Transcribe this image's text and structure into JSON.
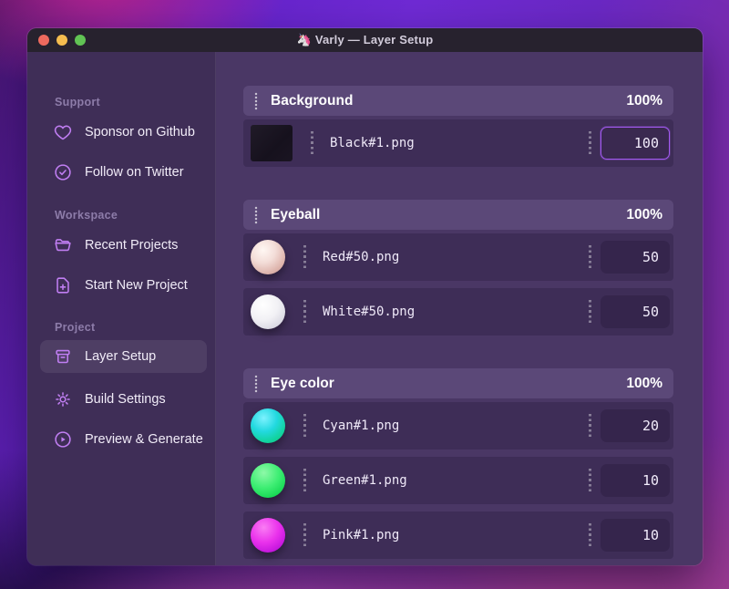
{
  "window": {
    "app_icon": "🦄",
    "title": "Varly — Layer Setup"
  },
  "sidebar": {
    "sections": [
      {
        "label": "Support",
        "items": [
          {
            "icon": "heart-icon",
            "label": "Sponsor on Github"
          },
          {
            "icon": "badge-check-icon",
            "label": "Follow on Twitter"
          }
        ]
      },
      {
        "label": "Workspace",
        "items": [
          {
            "icon": "folder-open-icon",
            "label": "Recent Projects"
          },
          {
            "icon": "document-plus-icon",
            "label": "Start New Project"
          }
        ]
      },
      {
        "label": "Project",
        "items": [
          {
            "icon": "archive-box-icon",
            "label": "Layer Setup",
            "selected": true
          },
          {
            "icon": "gear-icon",
            "label": "Build Settings"
          },
          {
            "icon": "play-circle-icon",
            "label": "Preview & Generate"
          }
        ]
      }
    ]
  },
  "main": {
    "groups": [
      {
        "name": "Background",
        "weight": "100%",
        "layers": [
          {
            "file": "Black#1.png",
            "value": "100",
            "thumb": "black-square",
            "focused": true
          }
        ]
      },
      {
        "name": "Eyeball",
        "weight": "100%",
        "layers": [
          {
            "file": "Red#50.png",
            "value": "50",
            "thumb": "red-ball"
          },
          {
            "file": "White#50.png",
            "value": "50",
            "thumb": "white-ball"
          }
        ]
      },
      {
        "name": "Eye color",
        "weight": "100%",
        "layers": [
          {
            "file": "Cyan#1.png",
            "value": "20",
            "thumb": "cyan-ball"
          },
          {
            "file": "Green#1.png",
            "value": "10",
            "thumb": "green-ball"
          },
          {
            "file": "Pink#1.png",
            "value": "10",
            "thumb": "pink-ball"
          }
        ]
      }
    ]
  },
  "colors": {
    "accent": "#c07ef2",
    "focus_border": "#a25af0",
    "window_bg": "#4a3765",
    "sidebar_bg": "#3f2e57",
    "row_bg": "#3e2d57",
    "header_bg": "#5b4878",
    "titlebar_bg": "#27222e"
  }
}
